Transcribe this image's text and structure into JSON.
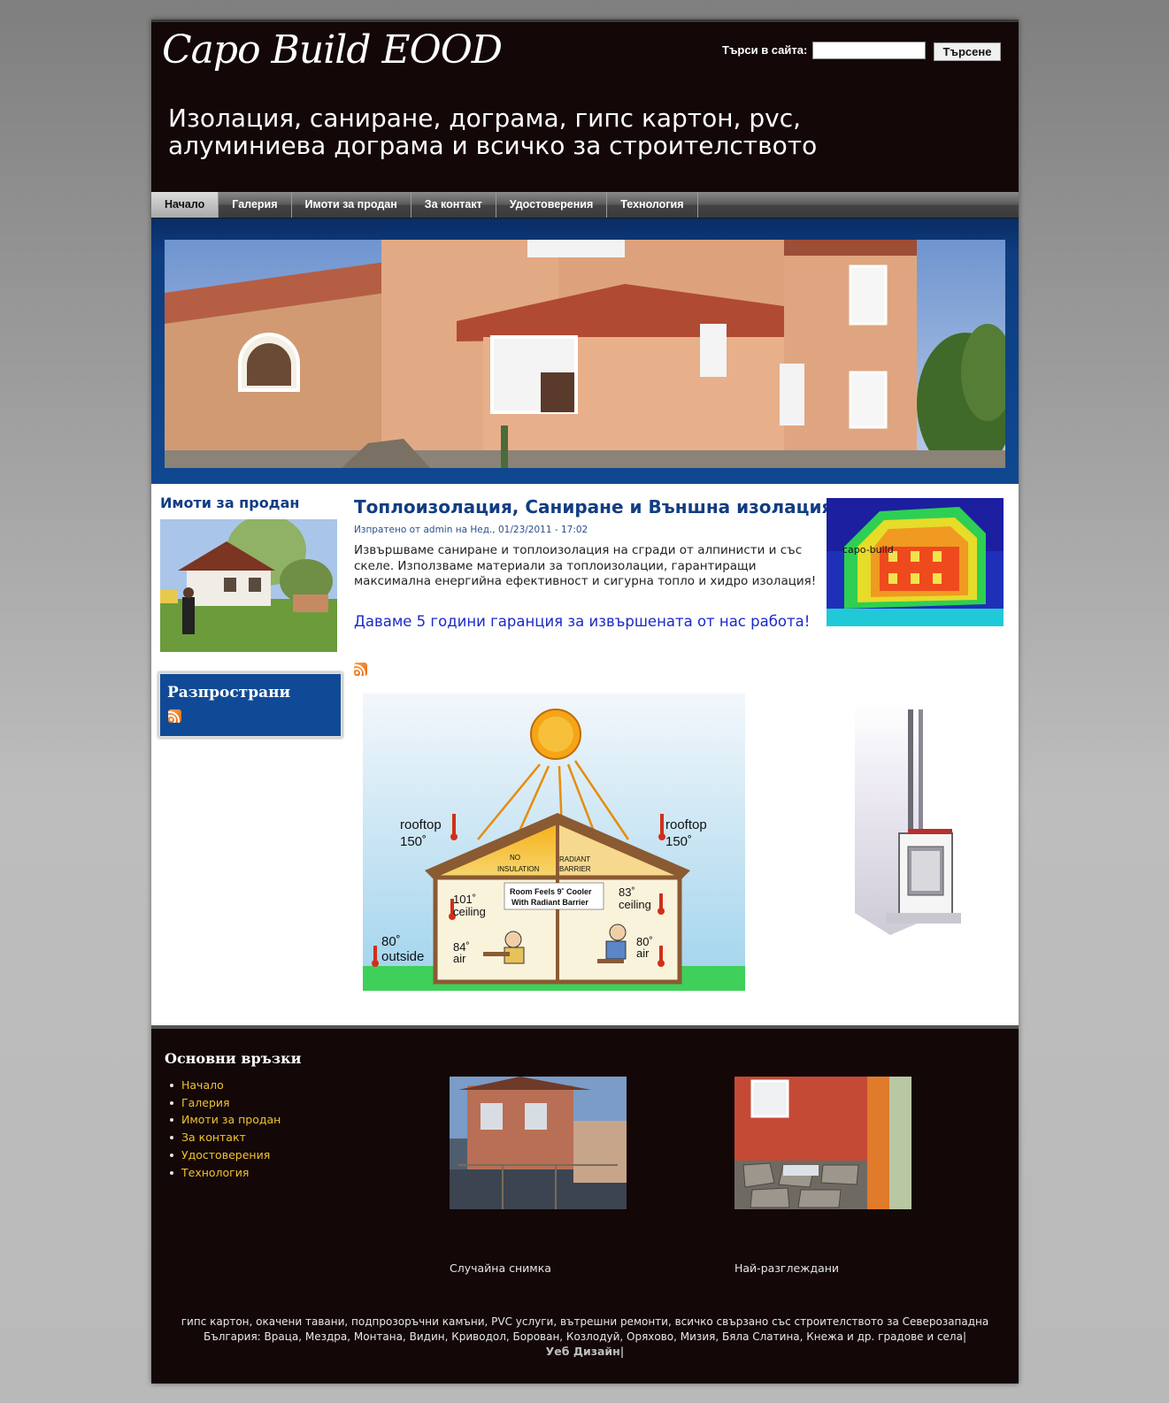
{
  "header": {
    "logo": "Capo Build EOOD",
    "search_label": "Търси в сайта:",
    "search_value": "",
    "search_button": "Търсене",
    "slogan": "Изолация, саниране, дограма, гипс картон, pvc, алуминиева дограма и всичко за строителството"
  },
  "nav": {
    "items": [
      "Начало",
      "Галерия",
      "Имоти за продан",
      "За контакт",
      "Удостоверения",
      "Технология"
    ],
    "active": "Начало"
  },
  "sidebar": {
    "sell_title": "Имоти за продан",
    "share_title": "Разпространи"
  },
  "article": {
    "title": "Топлоизолация, Саниране и Външна изолация",
    "meta": "Изпратено от admin на Нед., 01/23/2011 - 17:02",
    "body": "Извършваме саниране и топлоизолация на сгради от алпинисти и със скеле. Използваме материали за топлоизолации, гарантиращи максимална енергийна ефективност и сигурна топло и хидро изолация!",
    "guarantee": "Даваме 5 години гаранция за извършената от нас работа!",
    "thermal_label": "capo-build"
  },
  "diagram": {
    "rooftop_left": "rooftop",
    "rooftop_left_temp": "150˚",
    "rooftop_right": "rooftop",
    "rooftop_right_temp": "150˚",
    "no_insulation_1": "NO",
    "no_insulation_2": "INSULATION",
    "radiant_1": "RADIANT",
    "radiant_2": "BARRIER",
    "cooler_1": "Room Feels 9˚ Cooler",
    "cooler_2": "With Radiant Barrier",
    "ceiling_left_temp": "101˚",
    "ceiling_left": "ceiling",
    "ceiling_right_temp": "83˚",
    "ceiling_right": "ceiling",
    "outside_temp": "80˚",
    "outside": "outside",
    "air_left_temp": "84˚",
    "air_left": "air",
    "air_right_temp": "80˚",
    "air_right": "air"
  },
  "footer": {
    "links_title": "Основни връзки",
    "links": [
      "Начало",
      "Галерия",
      "Имоти за продан",
      "За контакт",
      "Удостоверения",
      "Технология"
    ],
    "random_caption": "Случайна снимка",
    "popular_caption": "Най-разглеждани",
    "text": "гипс картон, окачени тавани, подпрозоръчни камъни, PVC услуги, вътрешни ремонти, всичко свързано със строителството за Северозападна България: Враца, Мездра, Монтана, Видин, Криводол, Борован, Козлодуй, Оряхово, Мизия, Бяла Слатина, Кнежа и др. градове и села|",
    "credit": "Уеб Дизайн|"
  }
}
